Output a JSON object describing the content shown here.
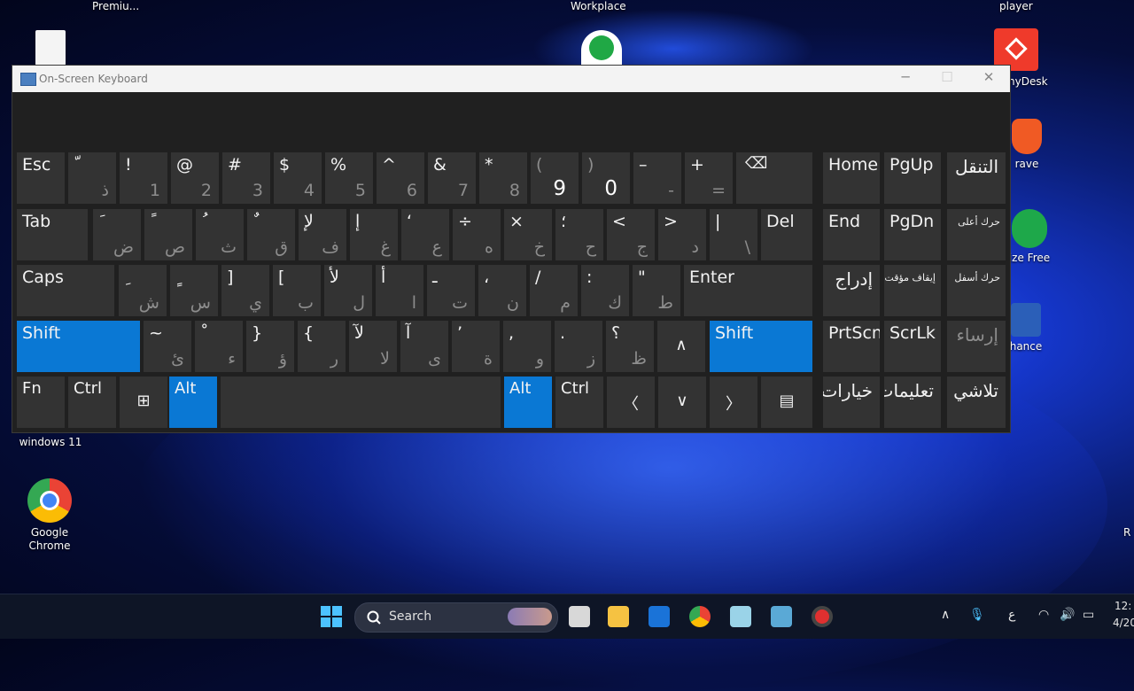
{
  "desktop": {
    "top_labels": [
      "Premiu...",
      "Workplace",
      "player"
    ],
    "right_icons": [
      "nyDesk",
      "rave",
      "ize Free",
      "hance"
    ],
    "left_labels": [
      "windows 11",
      "Google Chrome"
    ],
    "far_right_fragment": "R"
  },
  "window": {
    "title": "On-Screen Keyboard",
    "controls": {
      "minimize": "─",
      "maximize": "☐",
      "close": "✕"
    }
  },
  "keyboard": {
    "rows": [
      [
        {
          "top": "Esc"
        },
        {
          "top": "ّ",
          "bottom": "ذ"
        },
        {
          "top": "!",
          "bottom": "1"
        },
        {
          "top": "@",
          "bottom": "2"
        },
        {
          "top": "#",
          "bottom": "3"
        },
        {
          "top": "$",
          "bottom": "4"
        },
        {
          "top": "%",
          "bottom": "5"
        },
        {
          "top": "^",
          "bottom": "6"
        },
        {
          "top": "&",
          "bottom": "7"
        },
        {
          "top": "*",
          "bottom": "8"
        },
        {
          "top": "(",
          "bottom": "9"
        },
        {
          "top": ")",
          "bottom": "0"
        },
        {
          "top": "–",
          "bottom": "-"
        },
        {
          "top": "+",
          "bottom": "="
        },
        {
          "icon": "⌫"
        }
      ],
      [
        {
          "top": "Tab"
        },
        {
          "top": "َ",
          "bottom": "ض"
        },
        {
          "top": "ً",
          "bottom": "ص"
        },
        {
          "top": "ُ",
          "bottom": "ث"
        },
        {
          "top": "ٌ",
          "bottom": "ق"
        },
        {
          "top": "لإ",
          "bottom": "ف"
        },
        {
          "top": "إ",
          "bottom": "غ"
        },
        {
          "top": "‘",
          "bottom": "ع"
        },
        {
          "top": "÷",
          "bottom": "ه"
        },
        {
          "top": "×",
          "bottom": "خ"
        },
        {
          "top": "؛",
          "bottom": "ح"
        },
        {
          "top": "<",
          "bottom": "ج"
        },
        {
          "top": ">",
          "bottom": "د"
        },
        {
          "top": "|",
          "bottom": "\\"
        },
        {
          "top": "Del"
        }
      ],
      [
        {
          "top": "Caps"
        },
        {
          "top": "ِ",
          "bottom": "ش"
        },
        {
          "top": "ٍ",
          "bottom": "س"
        },
        {
          "top": "]",
          "bottom": "ي"
        },
        {
          "top": "[",
          "bottom": "ب"
        },
        {
          "top": "لأ",
          "bottom": "ل"
        },
        {
          "top": "أ",
          "bottom": "ا"
        },
        {
          "top": "ـ",
          "bottom": "ت"
        },
        {
          "top": "،",
          "bottom": "ن"
        },
        {
          "top": "/",
          "bottom": "م"
        },
        {
          "top": ":",
          "bottom": "ك"
        },
        {
          "top": "\"",
          "bottom": "ط"
        },
        {
          "top": "Enter"
        }
      ],
      [
        {
          "top": "Shift"
        },
        {
          "top": "~",
          "bottom": "ئ"
        },
        {
          "top": "ْ",
          "bottom": "ء"
        },
        {
          "top": "}",
          "bottom": "ؤ"
        },
        {
          "top": "{",
          "bottom": "ر"
        },
        {
          "top": "لآ",
          "bottom": "لا"
        },
        {
          "top": "آ",
          "bottom": "ى"
        },
        {
          "top": "’",
          "bottom": "ة"
        },
        {
          "top": ",",
          "bottom": "و"
        },
        {
          "top": ".",
          "bottom": "ز"
        },
        {
          "top": "؟",
          "bottom": "ظ"
        },
        {
          "icon": "∧"
        },
        {
          "top": "Shift"
        }
      ],
      [
        {
          "top": "Fn"
        },
        {
          "top": "Ctrl"
        },
        {
          "icon": "⊞"
        },
        {
          "top": "Alt"
        },
        {
          "top": ""
        },
        {
          "top": "Alt"
        },
        {
          "top": "Ctrl"
        },
        {
          "icon": "〈"
        },
        {
          "icon": "∨"
        },
        {
          "icon": "〉"
        },
        {
          "icon": "▤"
        }
      ]
    ],
    "nav": [
      [
        "Home",
        "PgUp",
        "التنقل"
      ],
      [
        "End",
        "PgDn",
        "حرك أعلى"
      ],
      [
        "إدراج",
        "إيقاف مؤقت",
        "حرك أسفل"
      ],
      [
        "PrtScn",
        "ScrLk",
        "إرساء"
      ],
      [
        "خيارات",
        "تعليمات",
        "تلاشي"
      ]
    ]
  },
  "taskbar": {
    "search_label": "Search",
    "tray": {
      "lang": "ع",
      "time": "12:",
      "date": "4/20"
    },
    "tray_icons": {
      "chevron": "∧",
      "mic": "🎙",
      "wifi": "◠",
      "volume": "🔊",
      "battery": "▭"
    }
  },
  "colors": {
    "key_bg": "#333333",
    "key_active": "#0a78d4",
    "window_bg": "#202020"
  }
}
